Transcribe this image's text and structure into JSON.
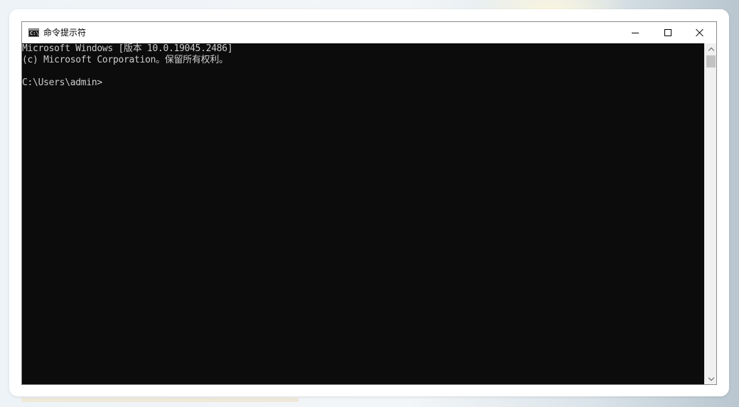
{
  "window": {
    "title": "命令提示符",
    "icon_label": "C:\\."
  },
  "controls": {
    "minimize": "minimize-icon",
    "maximize": "maximize-icon",
    "close": "close-icon"
  },
  "console": {
    "lines": [
      "Microsoft Windows [版本 10.0.19045.2486]",
      "(c) Microsoft Corporation。保留所有权利。",
      "",
      "C:\\Users\\admin>"
    ],
    "background": "#0c0c0c",
    "foreground": "#cccccc"
  }
}
